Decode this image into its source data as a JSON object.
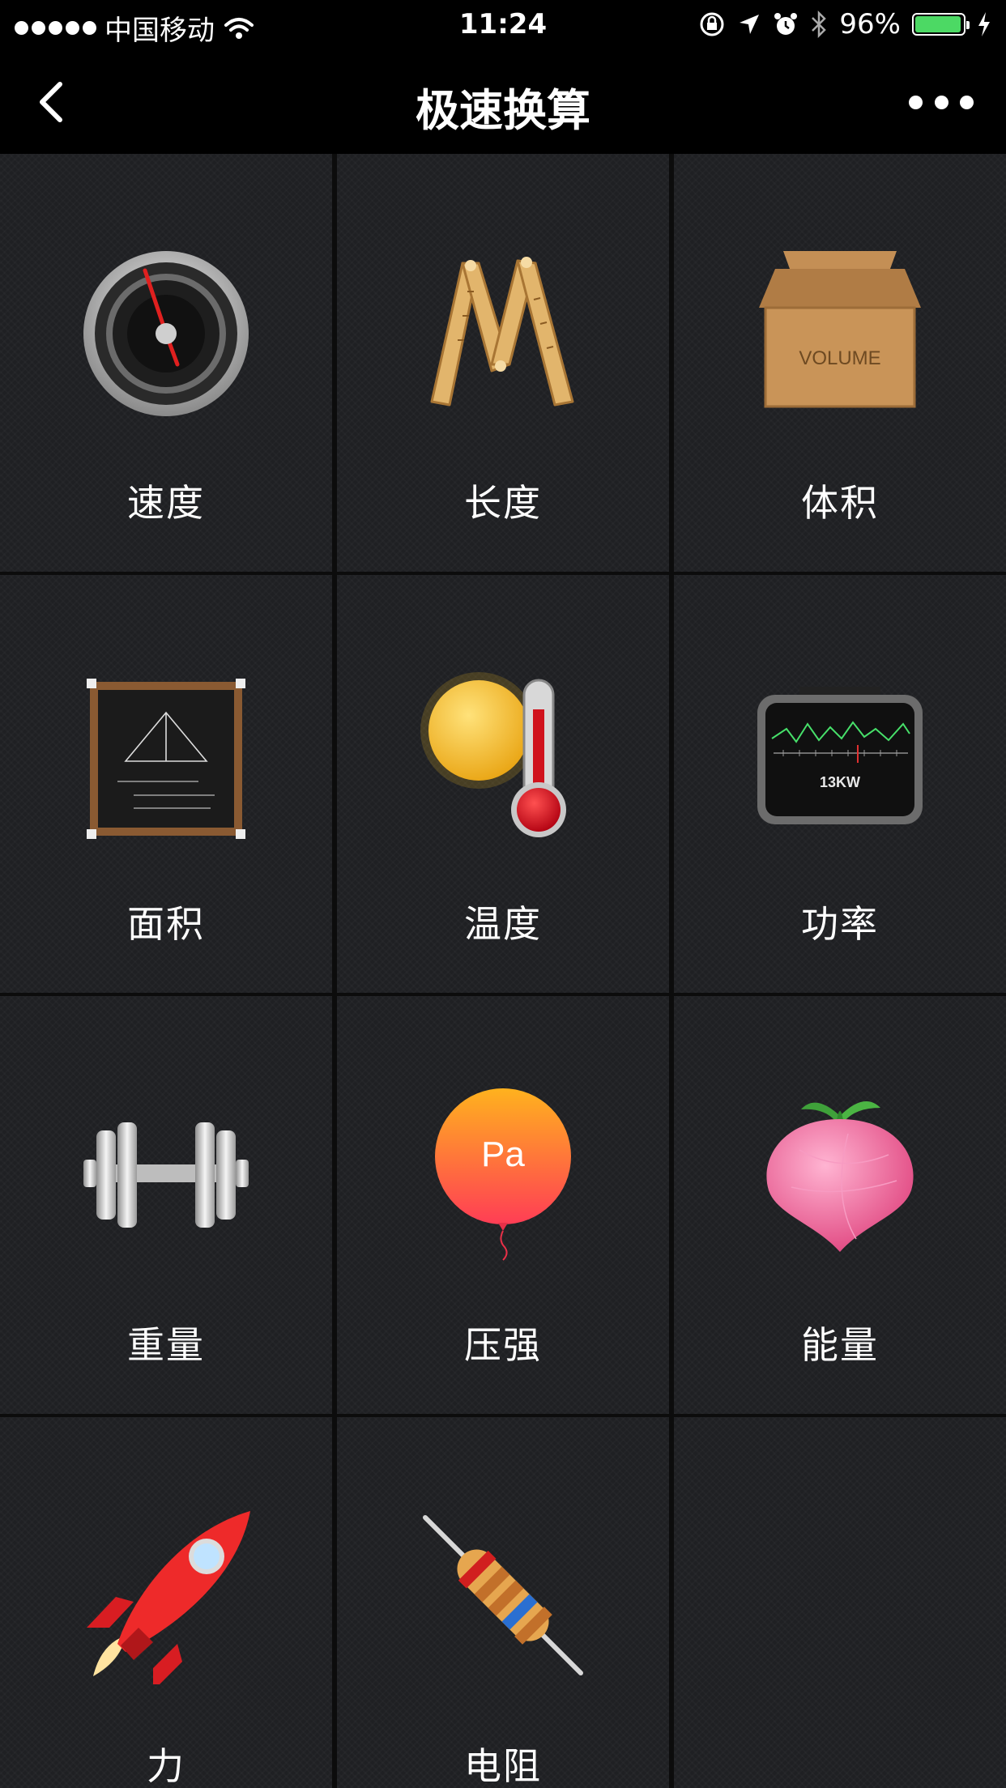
{
  "status_bar": {
    "carrier": "中国移动",
    "time": "11:24",
    "battery_percent": "96%",
    "battery_level": 0.96,
    "icons": [
      "signal-dots-icon",
      "wifi-icon",
      "rotation-lock-icon",
      "location-arrow-icon",
      "alarm-icon",
      "bluetooth-icon",
      "battery-icon",
      "charging-bolt-icon"
    ]
  },
  "nav": {
    "title": "极速换算",
    "back_icon": "chevron-left-icon",
    "more_icon": "more-dots-icon"
  },
  "categories": [
    {
      "label": "速度",
      "icon": "speedometer-icon"
    },
    {
      "label": "长度",
      "icon": "folding-ruler-icon"
    },
    {
      "label": "体积",
      "icon": "cardboard-box-icon",
      "icon_text": "VOLUME"
    },
    {
      "label": "面积",
      "icon": "chalkboard-triangle-icon"
    },
    {
      "label": "温度",
      "icon": "sun-thermometer-icon"
    },
    {
      "label": "功率",
      "icon": "power-meter-icon",
      "icon_text": "13KW"
    },
    {
      "label": "重量",
      "icon": "dumbbell-icon"
    },
    {
      "label": "压强",
      "icon": "balloon-icon",
      "icon_text": "Pa"
    },
    {
      "label": "能量",
      "icon": "radish-icon"
    },
    {
      "label": "力",
      "icon": "rocket-icon"
    },
    {
      "label": "电阻",
      "icon": "resistor-icon"
    }
  ]
}
